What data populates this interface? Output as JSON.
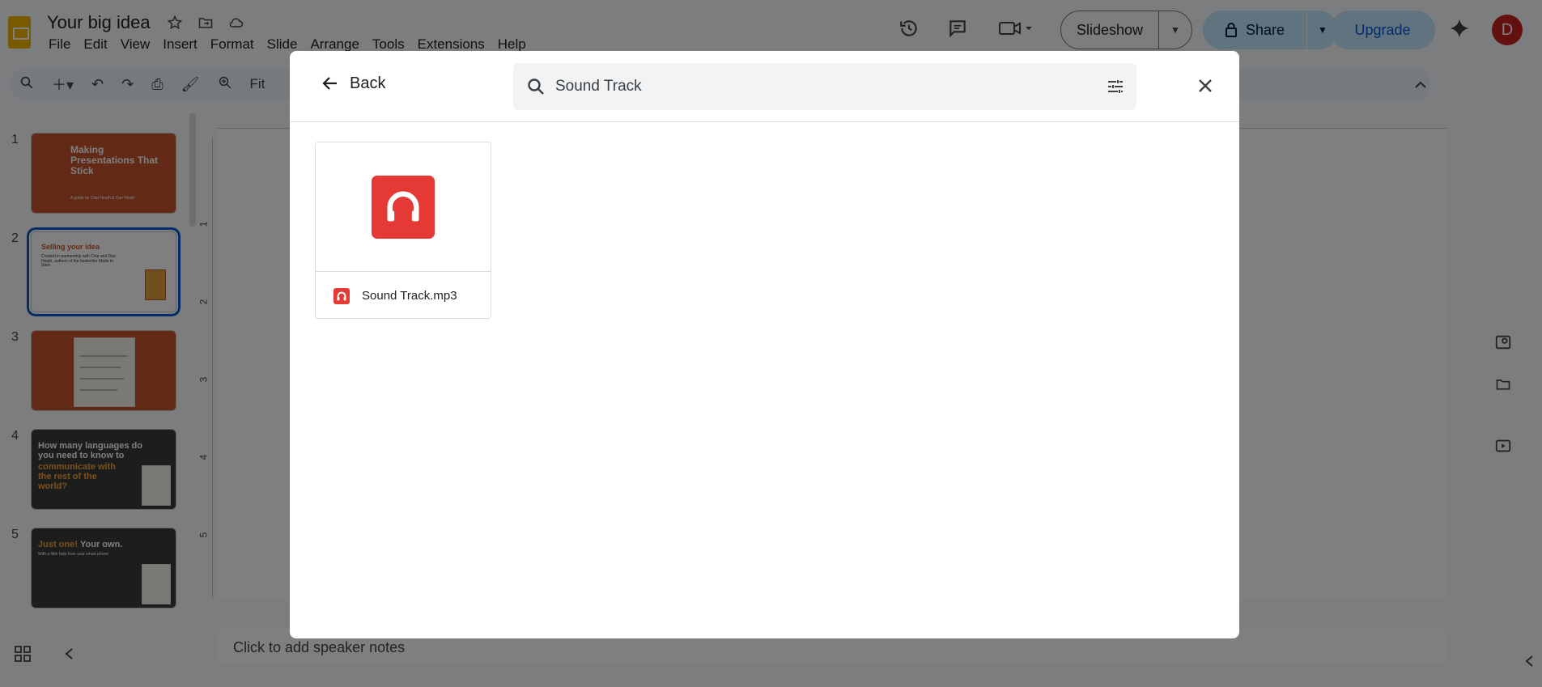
{
  "app": {
    "doc_title": "Your big idea",
    "menu": [
      "File",
      "Edit",
      "View",
      "Insert",
      "Format",
      "Slide",
      "Arrange",
      "Tools",
      "Extensions",
      "Help"
    ],
    "slideshow_label": "Slideshow",
    "share_label": "Share",
    "upgrade_label": "Upgrade",
    "avatar_letter": "D",
    "zoom_label": "Fit",
    "speaker_notes_placeholder": "Click to add speaker notes"
  },
  "slides": [
    {
      "number": "1",
      "title": "Making Presentations That Stick",
      "subtitle": "A guide by Chip Heath & Dan Heath"
    },
    {
      "number": "2",
      "title": "Selling your idea",
      "body": "Created in partnership with Chip and Dan Heath, authors of the bestseller Made to Stick."
    },
    {
      "number": "3",
      "title": "",
      "body": ""
    },
    {
      "number": "4",
      "title": "How many languages do you need to know to",
      "accent": "communicate with the rest of the world?"
    },
    {
      "number": "5",
      "title": "Just one!",
      "accent_title": "Your own.",
      "subtitle": "With a little help from your smart phone"
    }
  ],
  "ruler": [
    "1",
    "2",
    "3",
    "4",
    "5"
  ],
  "dialog": {
    "back_label": "Back",
    "search_value": "Sound Track",
    "results": [
      {
        "name": "Sound Track.mp3",
        "icon": "headphones-icon"
      }
    ]
  },
  "colors": {
    "accent": "#0b57d0",
    "audio_red": "#e53935",
    "slide_orange": "#c7532f",
    "slide_dark": "#3a3a3a"
  }
}
